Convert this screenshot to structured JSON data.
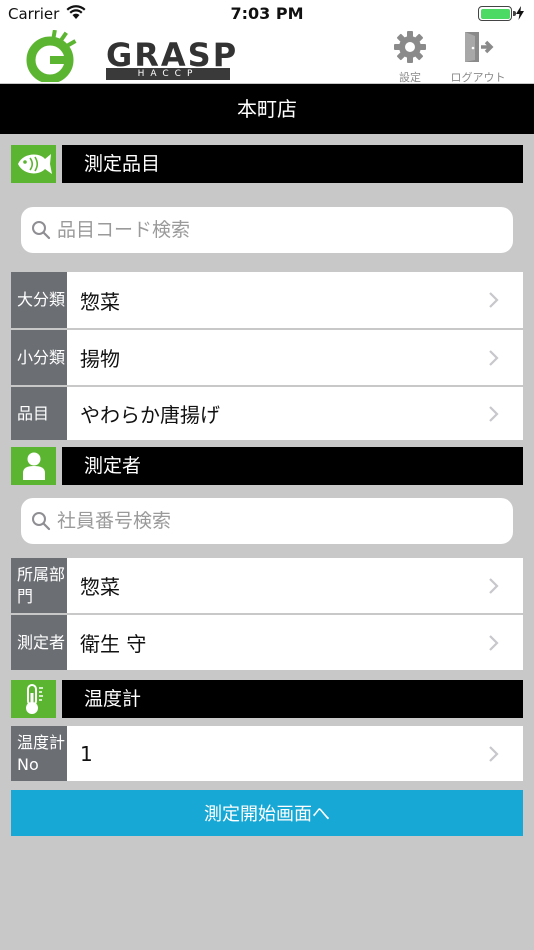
{
  "status": {
    "carrier": "Carrier",
    "time": "7:03 PM"
  },
  "header": {
    "logo_text": "GRASP",
    "logo_sub": "HACCP",
    "settings_label": "設定",
    "logout_label": "ログアウト"
  },
  "store": {
    "name": "本町店"
  },
  "sections": {
    "item": {
      "title": "測定品目",
      "search_placeholder": "品目コード検索",
      "rows": [
        {
          "label": "大分類",
          "value": "惣菜"
        },
        {
          "label": "小分類",
          "value": "揚物"
        },
        {
          "label": "品目",
          "value": "やわらか唐揚げ"
        }
      ]
    },
    "person": {
      "title": "測定者",
      "search_placeholder": "社員番号検索",
      "rows": [
        {
          "label": "所属部門",
          "value": "惣菜"
        },
        {
          "label": "測定者",
          "value": "衛生 守"
        }
      ]
    },
    "thermometer": {
      "title": "温度計",
      "rows": [
        {
          "label": "温度計No",
          "value": "1"
        }
      ]
    }
  },
  "actions": {
    "start_label": "測定開始画面へ"
  },
  "colors": {
    "accent_green": "#5cb531",
    "button_blue": "#17a8d6",
    "label_gray": "#6b6e73"
  }
}
